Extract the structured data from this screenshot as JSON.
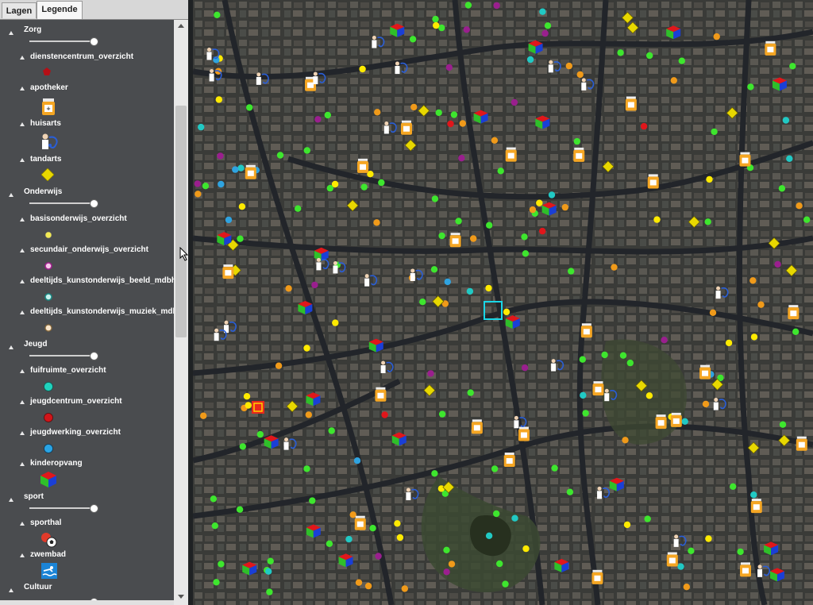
{
  "tabs": [
    {
      "label": "Lagen",
      "active": false
    },
    {
      "label": "Legende",
      "active": true
    }
  ],
  "legend": {
    "groups": [
      {
        "name": "Zorg",
        "layers": [
          {
            "name": "dienstencentrum_overzicht",
            "symbol": "red-pentagon"
          },
          {
            "name": "apotheker",
            "symbol": "pill-bottle-icon"
          },
          {
            "name": "huisarts",
            "symbol": "doctor-icon"
          },
          {
            "name": "tandarts",
            "symbol": "yellow-diamond"
          }
        ]
      },
      {
        "name": "Onderwijs",
        "layers": [
          {
            "name": "basisonderwijs_overzicht",
            "symbol": "yellow-dot"
          },
          {
            "name": "secundair_onderwijs_overzicht",
            "symbol": "magenta-dot"
          },
          {
            "name": "deeltijds_kunstonderwijs_beeld_mdbhe",
            "symbol": "light-cyan-dot"
          },
          {
            "name": "deeltijds_kunstonderwijs_muziek_mdb",
            "symbol": "peach-dot"
          }
        ]
      },
      {
        "name": "Jeugd",
        "layers": [
          {
            "name": "fuifruimte_overzicht",
            "symbol": "cyan-dot"
          },
          {
            "name": "jeugdcentrum_overzicht",
            "symbol": "red-dot"
          },
          {
            "name": "jeugdwerking_overzicht",
            "symbol": "blue-dot"
          },
          {
            "name": "kinderopvang",
            "symbol": "rgb-cube-icon"
          }
        ]
      },
      {
        "name": "sport",
        "layers": [
          {
            "name": "sporthal",
            "symbol": "sports-balls-icon"
          },
          {
            "name": "zwembad",
            "symbol": "swimmer-icon"
          }
        ]
      },
      {
        "name": "Cultuur",
        "layers": []
      }
    ]
  },
  "colors": {
    "panel_bg": "#4a4c4f",
    "green_point": "#3ee62e",
    "orange_point": "#f09a1a",
    "yellow_point": "#ffea00",
    "magenta_point": "#9a1f8e",
    "cyan_point": "#21c9c4",
    "blue_point": "#2fa3e0",
    "red_point": "#e0161b",
    "selection": "#1ad6e6"
  }
}
